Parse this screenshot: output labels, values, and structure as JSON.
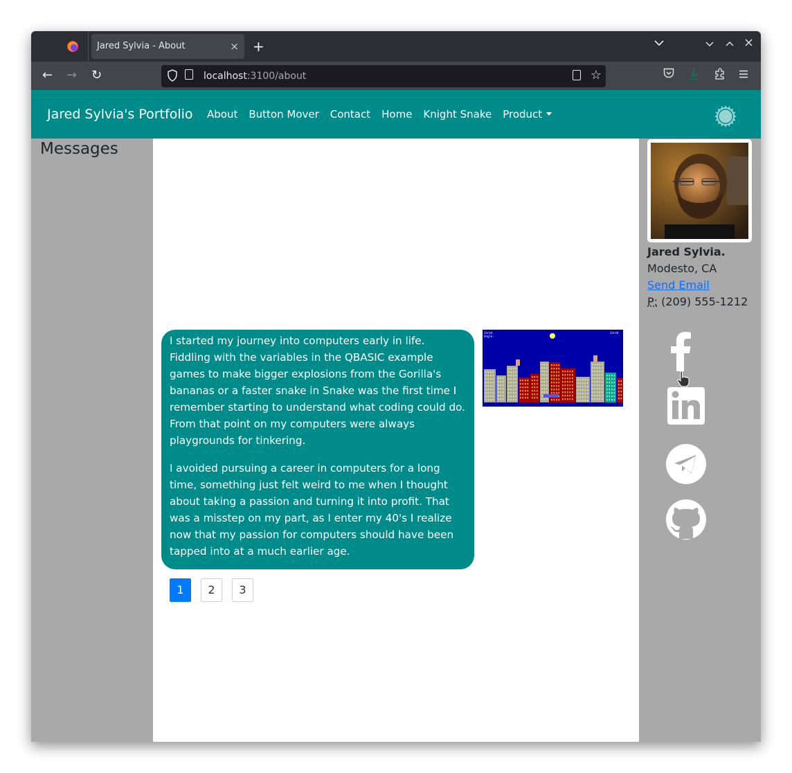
{
  "browser": {
    "tab_title": "Jared Sylvia - About",
    "tab_close": "×",
    "new_tab": "+",
    "tabs_list": "⌄",
    "window_controls": {
      "minimize": "⌄",
      "maximize": "⌃",
      "close": "✕"
    },
    "url_host": "localhost",
    "url_rest": ":3100/about",
    "nav": {
      "back": "←",
      "forward": "→",
      "reload": "↻"
    },
    "star": "☆",
    "pocket": "◡",
    "download": "⤓",
    "extensions": "⧉",
    "menu": "≡"
  },
  "site": {
    "brand": "Jared Sylvia's Portfolio",
    "menu": [
      {
        "label": "About"
      },
      {
        "label": "Button Mover"
      },
      {
        "label": "Contact"
      },
      {
        "label": "Home"
      },
      {
        "label": "Knight Snake"
      },
      {
        "label": "Product",
        "dropdown": true
      }
    ],
    "theme_toggle": "sun-icon"
  },
  "sidebar_left": {
    "heading": "Messages"
  },
  "main": {
    "paragraphs": [
      "I started my journey into computers early in life. Fiddling with the variables in the QBASIC example games to make bigger explosions from the Gorilla's bananas or a faster snake in Snake was the first time I remember starting to understand what coding could do. From that point on my computers were always playgrounds for tinkering.",
      "I avoided pursuing a career in computers for a long time, something just felt weird to me when I thought about taking a passion and turning it into profit. That was a misstep on my part, as I enter my 40's I realize now that my passion for computers should have been tapped into at a much earlier age."
    ],
    "image_alt": "QBASIC Gorillas game screenshot",
    "pagination": {
      "pages": [
        "1",
        "2",
        "3"
      ],
      "active": "1"
    }
  },
  "sidebar_right": {
    "name": "Jared Sylvia.",
    "location": "Modesto, CA",
    "email_link": "Send Email",
    "phone_label": "P:",
    "phone": " (209) 555-1212",
    "social": [
      "facebook",
      "linkedin",
      "telegram",
      "github"
    ]
  },
  "colors": {
    "brand_teal": "#008b8b",
    "sidebar_gray": "#a9a9a9",
    "pagination_active": "#007bff",
    "link": "#0d6efd"
  }
}
